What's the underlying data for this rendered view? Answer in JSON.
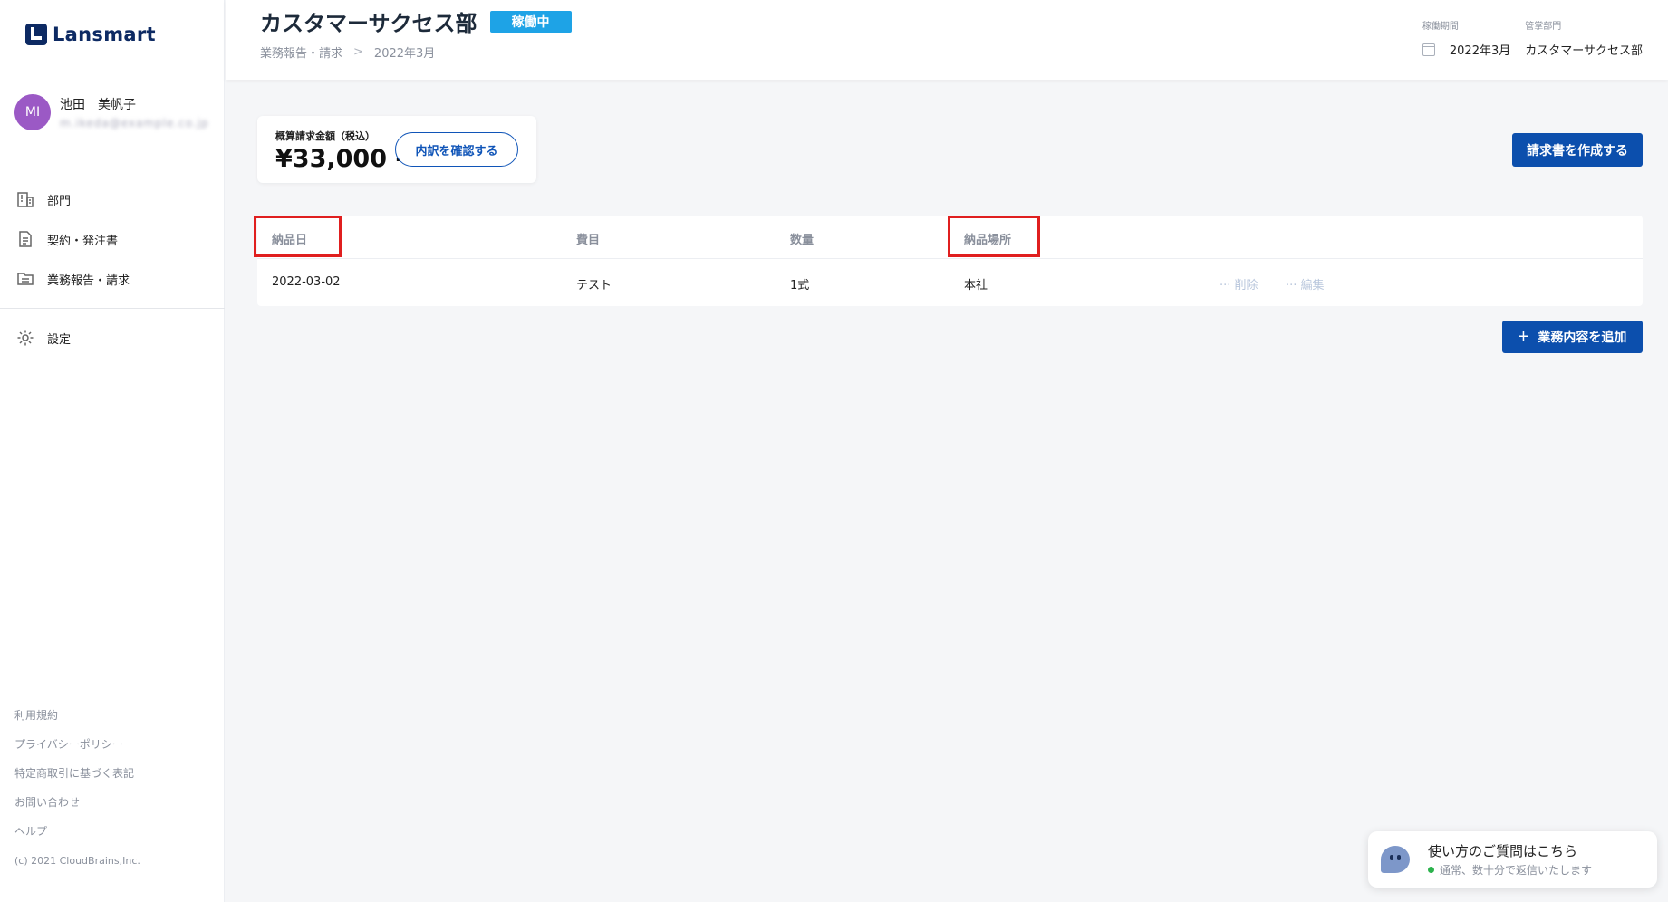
{
  "app": {
    "logo_text": "Lansmart"
  },
  "user": {
    "initials": "MI",
    "name": "池田　美帆子",
    "email": "m.ikeda@example.co.jp"
  },
  "sidebar": {
    "items": [
      {
        "label": "部門",
        "icon": "building-icon"
      },
      {
        "label": "契約・発注書",
        "icon": "document-icon"
      },
      {
        "label": "業務報告・請求",
        "icon": "folder-icon"
      },
      {
        "label": "設定",
        "icon": "gear-icon"
      }
    ],
    "footer_links": [
      "利用規約",
      "プライバシーポリシー",
      "特定商取引に基づく表記",
      "お問い合わせ",
      "ヘルプ"
    ],
    "copyright": "(c) 2021 CloudBrains,Inc."
  },
  "header": {
    "title": "カスタマーサクセス部",
    "status_badge": "稼働中",
    "breadcrumb": [
      "業務報告・請求",
      "2022年3月"
    ],
    "period_label": "稼働期間",
    "period_value": "2022年3月",
    "dept_label": "管掌部門",
    "dept_value": "カスタマーサクセス部"
  },
  "summary": {
    "label": "概算請求金額（税込）",
    "amount": "¥33,000 -",
    "breakdown_button": "内訳を確認する"
  },
  "actions": {
    "create_invoice": "請求書を作成する",
    "add_task": "業務内容を追加"
  },
  "table": {
    "columns": [
      "納品日",
      "費目",
      "数量",
      "納品場所"
    ],
    "rows": [
      {
        "date": "2022-03-02",
        "item": "テスト",
        "qty": "1式",
        "place": "本社",
        "delete": "··· 削除",
        "edit": "··· 編集"
      }
    ]
  },
  "chat": {
    "title": "使い方のご質問はこちら",
    "subtitle": "通常、数十分で返信いたします"
  },
  "colors": {
    "primary": "#0c4fad",
    "badge": "#1ea3e6",
    "highlight": "#e01f1f",
    "avatar": "#9b59c5"
  }
}
